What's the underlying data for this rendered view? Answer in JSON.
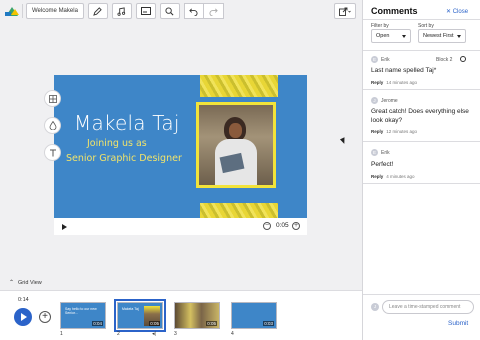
{
  "toolbar": {
    "project_name": "Welcome Makela",
    "icons": [
      "pencil-icon",
      "music-note-icon",
      "caption-icon",
      "search-icon",
      "undo-icon",
      "redo-icon",
      "share-icon"
    ]
  },
  "slide": {
    "title": "Makela Taj",
    "subtitle_line1": "Joining us as",
    "subtitle_line2": "Senior Graphic Designer",
    "bg_color": "#3e86c8",
    "accent_color": "#f2e33a",
    "time": "0:05"
  },
  "side_tools": [
    "layout-icon",
    "color-fill-icon",
    "text-icon"
  ],
  "timeline": {
    "grid_view_label": "Grid View",
    "current_time": "0:14",
    "thumbnails": [
      {
        "num": "1",
        "duration": "0:04",
        "text": "Say hello to our new Senior..."
      },
      {
        "num": "2",
        "duration": "0:05",
        "text": "Makela Taj"
      },
      {
        "num": "3",
        "duration": "0:05",
        "text": ""
      },
      {
        "num": "4",
        "duration": "0:03",
        "text": ""
      }
    ]
  },
  "comments_panel": {
    "title": "Comments",
    "close_label": "Close",
    "filter_label": "Filter by",
    "filter_value": "Open",
    "sort_label": "Sort by",
    "sort_value": "Newest First",
    "comments": [
      {
        "initial": "E",
        "author": "Erik",
        "block": "Block 2",
        "text": "Last name spelled Taj*",
        "reply": "Reply",
        "time": "14 minutes ago"
      },
      {
        "initial": "J",
        "author": "Jerome",
        "text": "Great catch! Does everything else look okay?",
        "reply": "Reply",
        "time": "12 minutes ago"
      },
      {
        "initial": "E",
        "author": "Erik",
        "text": "Perfect!",
        "reply": "Reply",
        "time": "4 minutes ago"
      }
    ],
    "new_comment_initial": "J",
    "new_comment_placeholder": "Leave a time-stamped comment",
    "submit_label": "Submit",
    "link_color": "#2b63c9"
  }
}
